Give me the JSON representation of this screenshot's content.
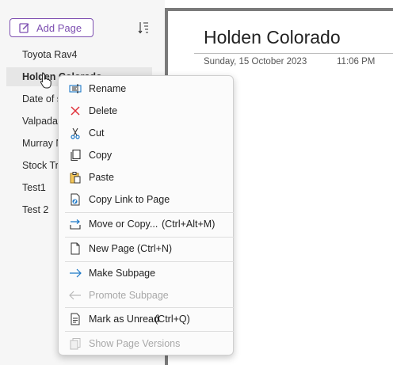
{
  "pages_pane": {
    "add_page_label": "Add Page",
    "pages": [
      {
        "title": "Toyota Rav4",
        "selected": false
      },
      {
        "title": "Holden Colorado",
        "selected": true
      },
      {
        "title": "Date of s",
        "selected": false
      },
      {
        "title": "Valpadar",
        "selected": false
      },
      {
        "title": "Murray N",
        "selected": false
      },
      {
        "title": "Stock Tra",
        "selected": false
      },
      {
        "title": "Test1",
        "selected": false
      },
      {
        "title": "Test 2",
        "selected": false
      }
    ]
  },
  "page": {
    "title": "Holden Colorado",
    "date": "Sunday, 15 October 2023",
    "time": "11:06 PM"
  },
  "context_menu": {
    "items": [
      {
        "label": "Rename",
        "shortcut": "",
        "icon": "rename-icon",
        "disabled": false
      },
      {
        "label": "Delete",
        "shortcut": "",
        "icon": "delete-icon",
        "disabled": false
      },
      {
        "label": "Cut",
        "shortcut": "",
        "icon": "cut-icon",
        "disabled": false
      },
      {
        "label": "Copy",
        "shortcut": "",
        "icon": "copy-icon",
        "disabled": false
      },
      {
        "label": "Paste",
        "shortcut": "",
        "icon": "paste-icon",
        "disabled": false
      },
      {
        "label": "Copy Link to Page",
        "shortcut": "",
        "icon": "link-icon",
        "disabled": false
      },
      {
        "label": "Move or Copy...",
        "shortcut": "(Ctrl+Alt+M)",
        "icon": "move-icon",
        "disabled": false
      },
      {
        "label": "New Page",
        "shortcut": "(Ctrl+N)",
        "icon": "new-page-icon",
        "disabled": false
      },
      {
        "label": "Make Subpage",
        "shortcut": "",
        "icon": "arrow-right-icon",
        "disabled": false
      },
      {
        "label": "Promote Subpage",
        "shortcut": "",
        "icon": "arrow-left-icon",
        "disabled": true
      },
      {
        "label": "Mark as Unread",
        "shortcut": "(Ctrl+Q)",
        "icon": "unread-icon",
        "disabled": false
      },
      {
        "label": "Show Page Versions",
        "shortcut": "",
        "icon": "page-versions-icon",
        "disabled": true
      }
    ]
  },
  "colors": {
    "accent": "#7d4fb1",
    "delete_red": "#e0313a",
    "link_blue": "#1e79c8"
  }
}
